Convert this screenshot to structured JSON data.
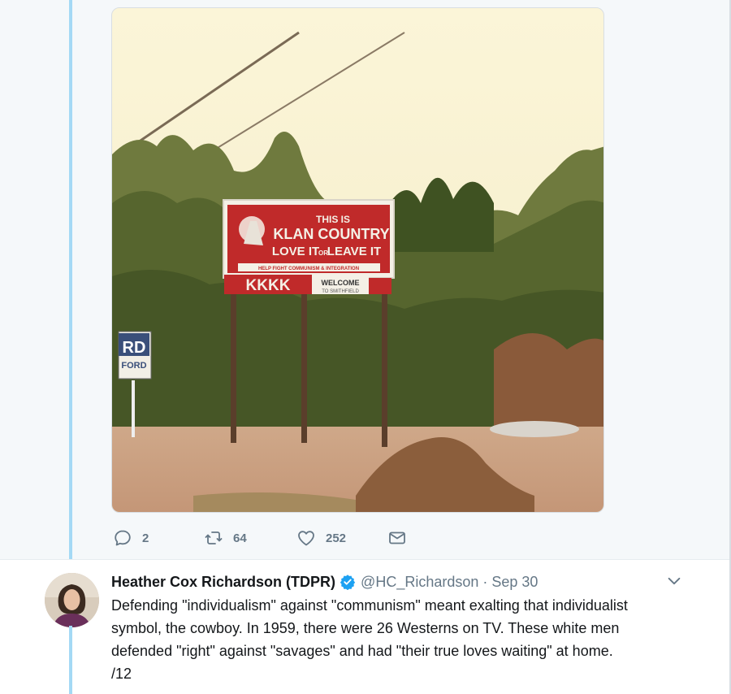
{
  "previous_tweet": {
    "media": {
      "sign_line1": "THIS IS",
      "sign_line2": "KLAN COUNTRY",
      "sign_line3a": "LOVE IT",
      "sign_line3b": "OR",
      "sign_line3c": "LEAVE IT",
      "sign_banner": "HELP FIGHT COMMUNISM & INTEGRATION",
      "sign_kkkk": "KKKK",
      "sign_welcome": "WELCOME",
      "sign_town": "TO SMITHFIELD",
      "side_sign_top": "RD",
      "side_sign_bottom": "FORD"
    },
    "actions": {
      "reply_count": "2",
      "retweet_count": "64",
      "like_count": "252"
    }
  },
  "tweet": {
    "author_name": "Heather Cox Richardson (TDPR)",
    "handle": "@HC_Richardson",
    "separator": "·",
    "date": "Sep 30",
    "text_lines": [
      "Defending \"individualism\" against \"communism\" meant exalting that individualist",
      "symbol, the cowboy. In 1959, there were 26 Westerns on TV. These white men",
      "defended \"right\" against \"savages\" and had \"their true loves waiting\" at home.",
      "/12"
    ]
  },
  "colors": {
    "thread_line": "#a4d9f5",
    "verified": "#1da1f2",
    "secondary_text": "#657786",
    "sign_red": "#c02a2a"
  }
}
